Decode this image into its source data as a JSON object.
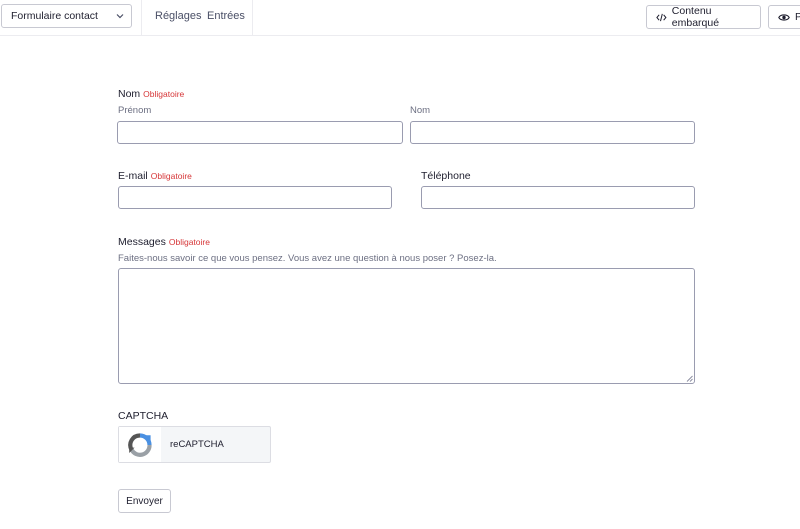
{
  "topbar": {
    "form_select_value": "Formulaire contact",
    "tabs": [
      {
        "label": "Réglages"
      },
      {
        "label": "Entrées"
      }
    ],
    "embed_button_label": "Contenu embarqué",
    "preview_button_label": "P"
  },
  "form": {
    "name": {
      "label": "Nom",
      "required_label": "Obligatoire",
      "first_sublabel": "Prénom",
      "last_sublabel": "Nom",
      "first_value": "",
      "last_value": ""
    },
    "email": {
      "label": "E-mail",
      "required_label": "Obligatoire",
      "value": ""
    },
    "phone": {
      "label": "Téléphone",
      "value": ""
    },
    "message": {
      "label": "Messages",
      "required_label": "Obligatoire",
      "description": "Faites-nous savoir ce que vous pensez. Vous avez une question à nous poser ? Posez-la.",
      "value": ""
    },
    "captcha": {
      "label": "CAPTCHA",
      "widget_text": "reCAPTCHA"
    },
    "submit_label": "Envoyer"
  },
  "colors": {
    "required": "#d63638",
    "border": "#9a9cb0",
    "recaptcha_blue": "#4a90e2",
    "recaptcha_dark": "#555555"
  },
  "icons": [
    "chevron-down-icon",
    "code-icon",
    "eye-icon",
    "recaptcha-logo-icon",
    "resize-handle-icon"
  ]
}
